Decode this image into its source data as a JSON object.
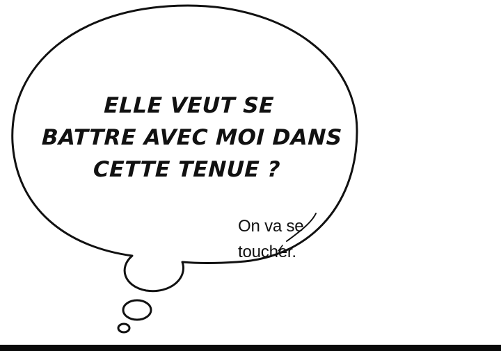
{
  "speech_bubble": {
    "lines": [
      "ELLE VEUT SE",
      "BATTRE AVEC MOI DANS",
      "CETTE TENUE ?"
    ]
  },
  "side_caption": {
    "lines": [
      "On va se",
      "toucher."
    ]
  },
  "colors": {
    "background": "#ffffff",
    "ink": "#111111",
    "bottom_bar": "#0a0a0a"
  }
}
